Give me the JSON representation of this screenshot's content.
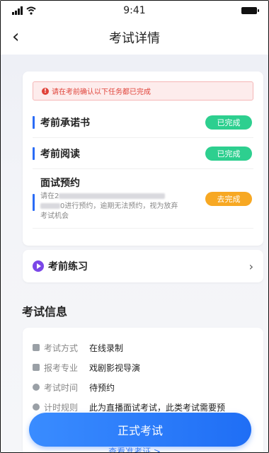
{
  "status_bar": {
    "time": "9:41"
  },
  "nav": {
    "title": "考试详情"
  },
  "tasks": {
    "alert": "请在考前确认以下任务都已完成",
    "items": [
      {
        "label": "考前承诺书",
        "status": "已完成"
      },
      {
        "label": "考前阅读",
        "status": "已完成"
      },
      {
        "label": "面试预约",
        "status": "去完成",
        "desc_prefix": "请在2",
        "desc_suffix": "0进行预约，逾期无法预约，视为放弃考试机会"
      }
    ]
  },
  "practice": {
    "label": "考前练习"
  },
  "info": {
    "section_title": "考试信息",
    "rows": [
      {
        "key": "考试方式",
        "value": "在线录制",
        "icon": "doc-icon"
      },
      {
        "key": "报考专业",
        "value": "戏剧影视导演",
        "icon": "book-icon"
      },
      {
        "key": "考试时间",
        "value": "待预约",
        "icon": "clock-icon"
      },
      {
        "key": "计时规则",
        "value": "此为直播面试考试，此类考试需要预",
        "icon": "timer-icon"
      }
    ]
  },
  "actions": {
    "start": "正式考试",
    "ticket": "查看准考证 >"
  },
  "colors": {
    "accent": "#1f6ef5",
    "done": "#2dcf8f",
    "todo": "#f7a823",
    "alert": "#e0433a",
    "practice": "#7b47e8"
  }
}
